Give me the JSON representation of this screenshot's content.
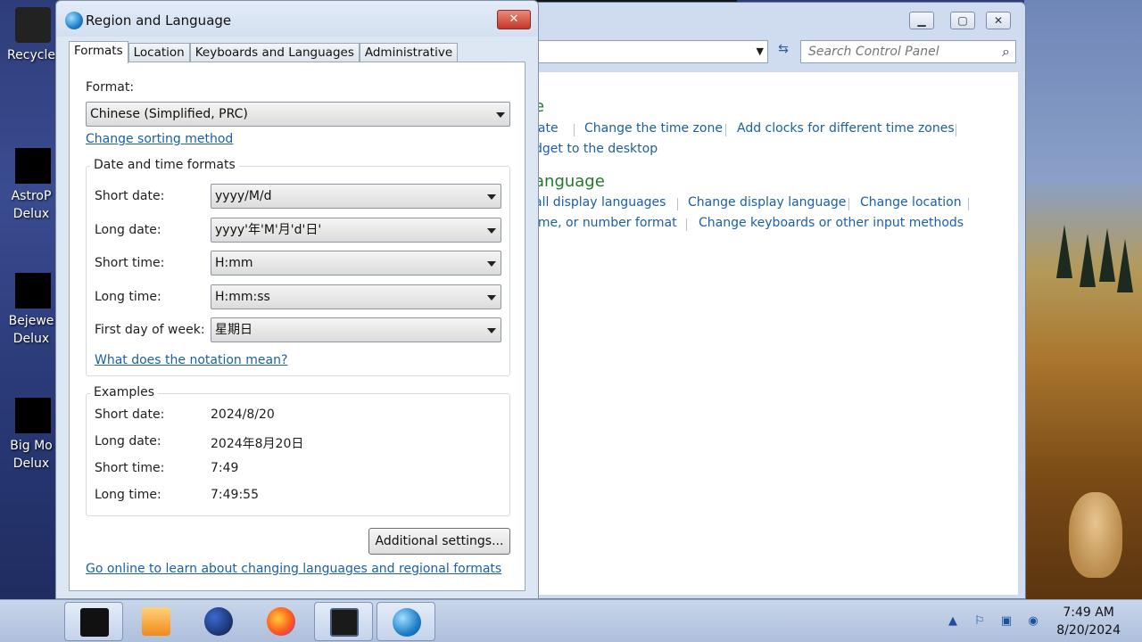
{
  "desktop": {
    "icons": [
      {
        "label_line1": "Recycle",
        "label_line2": ""
      },
      {
        "label_line1": "AstroP",
        "label_line2": "Delux"
      },
      {
        "label_line1": "Bejewe",
        "label_line2": "Delux"
      },
      {
        "label_line1": "Big Mo",
        "label_line2": "Delux"
      }
    ]
  },
  "control_panel": {
    "search_placeholder": "Search Control Panel",
    "heading1_partial": "e",
    "heading2_partial": "anguage",
    "links": {
      "set_date": "late",
      "change_time_zone": "Change the time zone",
      "add_clocks": "Add clocks for different time zones",
      "gadget": "dget to the desktop",
      "install_display_languages": "all display languages",
      "change_display_language": "Change display language",
      "change_location": "Change location",
      "format": "ime, or number format",
      "change_keyboards": "Change keyboards or other input methods"
    }
  },
  "dialog": {
    "title": "Region and Language",
    "close_label": "✕",
    "tabs": [
      "Formats",
      "Location",
      "Keyboards and Languages",
      "Administrative"
    ],
    "format_label": "Format:",
    "format_value": "Chinese (Simplified, PRC)",
    "change_sorting": "Change sorting method",
    "date_time_group": "Date and time formats",
    "fields": {
      "short_date": {
        "label": "Short date:",
        "value": "yyyy/M/d"
      },
      "long_date": {
        "label": "Long date:",
        "value": "yyyy'年'M'月'd'日'"
      },
      "short_time": {
        "label": "Short time:",
        "value": "H:mm"
      },
      "long_time": {
        "label": "Long time:",
        "value": "H:mm:ss"
      },
      "first_day": {
        "label": "First day of week:",
        "value": "星期日"
      }
    },
    "notation_link": "What does the notation mean?",
    "examples_group": "Examples",
    "examples": {
      "short_date": {
        "label": "Short date:",
        "value": "2024/8/20"
      },
      "long_date": {
        "label": "Long date:",
        "value": "2024年8月20日"
      },
      "short_time": {
        "label": "Short time:",
        "value": "7:49"
      },
      "long_time": {
        "label": "Long time:",
        "value": "7:49:55"
      }
    },
    "additional_settings": "Additional settings...",
    "online_link": "Go online to learn about changing languages and regional formats"
  },
  "taskbar": {
    "clock_time": "7:49 AM",
    "clock_date": "8/20/2024"
  },
  "colors": {
    "link": "#1a5fa8",
    "heading_green": "#1f7a2a"
  }
}
